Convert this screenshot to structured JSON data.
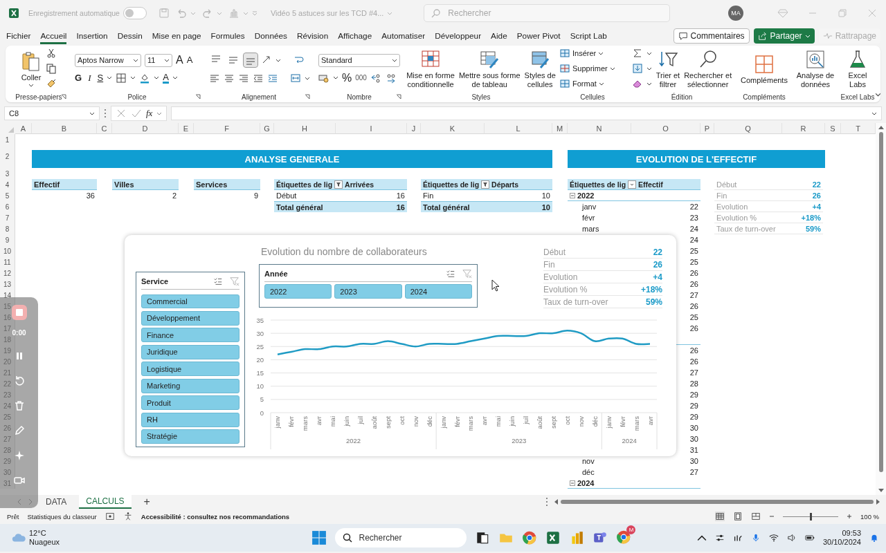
{
  "title_bar": {
    "autosave_label": "Enregistrement automatique",
    "autosave_on": false,
    "document_title": "Vidéo 5 astuces sur les TCD #4...",
    "search_placeholder": "Rechercher",
    "avatar": "MA"
  },
  "menu_tabs": [
    {
      "label": "Fichier",
      "selected": false
    },
    {
      "label": "Accueil",
      "selected": true
    },
    {
      "label": "Insertion",
      "selected": false
    },
    {
      "label": "Dessin",
      "selected": false
    },
    {
      "label": "Mise en page",
      "selected": false
    },
    {
      "label": "Formules",
      "selected": false
    },
    {
      "label": "Données",
      "selected": false
    },
    {
      "label": "Révision",
      "selected": false
    },
    {
      "label": "Affichage",
      "selected": false
    },
    {
      "label": "Automatiser",
      "selected": false
    },
    {
      "label": "Développeur",
      "selected": false
    },
    {
      "label": "Aide",
      "selected": false
    },
    {
      "label": "Power Pivot",
      "selected": false
    },
    {
      "label": "Script Lab",
      "selected": false
    }
  ],
  "menu_buttons": {
    "comments": "Commentaires",
    "share": "Partager",
    "catch_up": "Rattrapage",
    "catch_up_disabled": true
  },
  "ribbon": {
    "clipboard": {
      "label": "Presse-papiers",
      "paste": "Coller"
    },
    "font": {
      "label": "Police",
      "font_name": "Aptos Narrow",
      "font_size": "11",
      "grow": "A",
      "shrink": "A",
      "bold": "G",
      "italic": "I",
      "underline": "S",
      "font_color": "A"
    },
    "alignment": {
      "label": "Alignement",
      "vertical_buttons": [
        {
          "selected": false
        },
        {
          "selected": false
        },
        {
          "selected": true
        }
      ]
    },
    "number": {
      "label": "Nombre",
      "format": "Standard",
      "percent": "%",
      "thousands": "000"
    },
    "styles": {
      "label": "Styles",
      "buttons": [
        {
          "lines": [
            "Mise en forme",
            "conditionnelle"
          ]
        },
        {
          "lines": [
            "Mettre sous forme",
            "de tableau"
          ]
        },
        {
          "lines": [
            "Styles de",
            "cellules"
          ]
        }
      ]
    },
    "cells": {
      "label": "Cellules",
      "buttons": [
        "Insérer",
        "Supprimer",
        "Format"
      ]
    },
    "editing": {
      "label": "Édition",
      "buttons": [
        {
          "lines": [
            "Trier et",
            "filtrer"
          ]
        },
        {
          "lines": [
            "Rechercher et",
            "sélectionner"
          ]
        }
      ]
    },
    "addins": {
      "label": "Compléments",
      "button": "Compléments"
    },
    "data_analysis": {
      "lines": [
        "Analyse de",
        "données"
      ]
    },
    "excel_labs": {
      "label": "Excel Labs",
      "lines": [
        "Excel",
        "Labs"
      ]
    }
  },
  "formula_bar": {
    "name_box": "C8",
    "function_label": "fx"
  },
  "sheet": {
    "columns": [
      "A",
      "B",
      "C",
      "D",
      "E",
      "F",
      "G",
      "H",
      "I",
      "J",
      "K",
      "L",
      "M",
      "N",
      "O",
      "P",
      "Q",
      "R",
      "S",
      "T"
    ],
    "row_numbers": [
      "1",
      "2",
      "3",
      "4",
      "5",
      "6",
      "7",
      "8",
      "9",
      "10",
      "11",
      "12",
      "13",
      "14",
      "15",
      "16",
      "17",
      "18",
      "19",
      "20",
      "21",
      "22",
      "23",
      "24",
      "25",
      "26",
      "27",
      "28",
      "29",
      "30",
      "31"
    ],
    "banners": [
      "ANALYSE GENERALE",
      "EVOLUTION DE L'EFFECTIF"
    ],
    "kpis": [
      {
        "label": "Effectif",
        "value": "36"
      },
      {
        "label": "Villes",
        "value": "2"
      },
      {
        "label": "Services",
        "value": "9"
      }
    ],
    "small_pivots": [
      {
        "row_header": "Étiquettes de lig",
        "filtered": true,
        "value_header": "Arrivées",
        "rows": [
          {
            "label": "Début",
            "value": "16"
          }
        ],
        "total_label": "Total général",
        "total": "16"
      },
      {
        "row_header": "Étiquettes de lig",
        "filtered": true,
        "value_header": "Départs",
        "rows": [
          {
            "label": "Fin",
            "value": "10"
          }
        ],
        "total_label": "Total général",
        "total": "10"
      }
    ],
    "effectif_pivot": {
      "row_header": "Étiquettes de lig",
      "filtered": false,
      "value_header": "Effectif",
      "rows": [
        {
          "kind": "year",
          "label": "2022",
          "expanded": true
        },
        {
          "kind": "month",
          "label": "janv",
          "value": "22"
        },
        {
          "kind": "month",
          "label": "févr",
          "value": "23"
        },
        {
          "kind": "month",
          "label": "mars",
          "value": "24"
        },
        {
          "kind": "month",
          "value": "24"
        },
        {
          "kind": "month",
          "value": "25"
        },
        {
          "kind": "month",
          "value": "25"
        },
        {
          "kind": "month",
          "value": "26"
        },
        {
          "kind": "month",
          "value": "26"
        },
        {
          "kind": "month",
          "value": "27"
        },
        {
          "kind": "month",
          "value": "26"
        },
        {
          "kind": "month",
          "value": "25"
        },
        {
          "kind": "month",
          "value": "26"
        },
        {
          "kind": "year"
        },
        {
          "kind": "month",
          "value": "26"
        },
        {
          "kind": "month",
          "value": "26"
        },
        {
          "kind": "month",
          "value": "27"
        },
        {
          "kind": "month",
          "value": "28"
        },
        {
          "kind": "month",
          "value": "29"
        },
        {
          "kind": "month",
          "value": "29"
        },
        {
          "kind": "month",
          "value": "29"
        },
        {
          "kind": "month",
          "value": "30"
        },
        {
          "kind": "month",
          "value": "30"
        },
        {
          "kind": "month",
          "value": "31"
        },
        {
          "kind": "month",
          "label": "nov",
          "value": "30"
        },
        {
          "kind": "month",
          "label": "déc",
          "value": "27"
        },
        {
          "kind": "year",
          "label": "2024",
          "expanded": true
        }
      ]
    },
    "summary": [
      {
        "label": "Début",
        "value": "22"
      },
      {
        "label": "Fin",
        "value": "26"
      },
      {
        "label": "Evolution",
        "value": "+4"
      },
      {
        "label": "Evolution %",
        "value": "+18%"
      },
      {
        "label": "Taux de turn-over",
        "value": "59%"
      }
    ]
  },
  "dashboard": {
    "service_slicer": {
      "title": "Service",
      "items": [
        {
          "label": "Commercial",
          "selected": true
        },
        {
          "label": "Développement",
          "selected": true
        },
        {
          "label": "Finance",
          "selected": true
        },
        {
          "label": "Juridique",
          "selected": true
        },
        {
          "label": "Logistique",
          "selected": true
        },
        {
          "label": "Marketing",
          "selected": true
        },
        {
          "label": "Produit",
          "selected": true
        },
        {
          "label": "RH",
          "selected": true
        },
        {
          "label": "Stratégie",
          "selected": true
        }
      ]
    },
    "year_slicer": {
      "title": "Année",
      "items": [
        {
          "label": "2022",
          "selected": true
        },
        {
          "label": "2023",
          "selected": true
        },
        {
          "label": "2024",
          "selected": true
        }
      ]
    },
    "summary": [
      {
        "label": "Début",
        "value": "22"
      },
      {
        "label": "Fin",
        "value": "26"
      },
      {
        "label": "Evolution",
        "value": "+4"
      },
      {
        "label": "Evolution %",
        "value": "+18%"
      },
      {
        "label": "Taux de turn-over",
        "value": "59%"
      }
    ],
    "chart_data": {
      "type": "line",
      "title": "Evolution du nombre de collaborateurs",
      "categories": [
        "janv",
        "févr",
        "mars",
        "avr",
        "mai",
        "juin",
        "juil",
        "août",
        "sept",
        "oct",
        "nov",
        "déc",
        "janv",
        "févr",
        "mars",
        "avr",
        "mai",
        "juin",
        "juil",
        "août",
        "sept",
        "oct",
        "nov",
        "déc",
        "janv",
        "févr",
        "mars",
        "avr"
      ],
      "annotations": [
        "2022",
        "2023",
        "2024"
      ],
      "grid": true,
      "values": [
        22,
        23,
        24,
        24,
        25,
        25,
        26,
        26,
        27,
        26,
        25,
        26,
        26,
        26,
        27,
        28,
        29,
        29,
        29,
        30,
        30,
        31,
        30,
        27,
        28,
        28,
        26,
        26
      ],
      "ylim": [
        0,
        35
      ],
      "yticks": [
        0,
        5,
        10,
        15,
        20,
        25,
        30,
        35
      ]
    }
  },
  "sheet_tabs": [
    {
      "label": "DATA",
      "selected": false
    },
    {
      "label": "CALCULS",
      "selected": true
    }
  ],
  "add_sheet": "+",
  "status_bar": {
    "ready": "Prêt",
    "workbook_stats": "Statistiques du classeur",
    "accessibility": "Accessibilité : consultez nos recommandations",
    "zoom": {
      "level": 0.5
    },
    "zoom_label": "100 %"
  },
  "taskbar": {
    "temperature": "12°C",
    "weather": "Nuageux",
    "search_placeholder": "Rechercher",
    "badge": "M",
    "time": "09:53",
    "date": "30/10/2024"
  },
  "recorder": {
    "timer": "0:00"
  }
}
